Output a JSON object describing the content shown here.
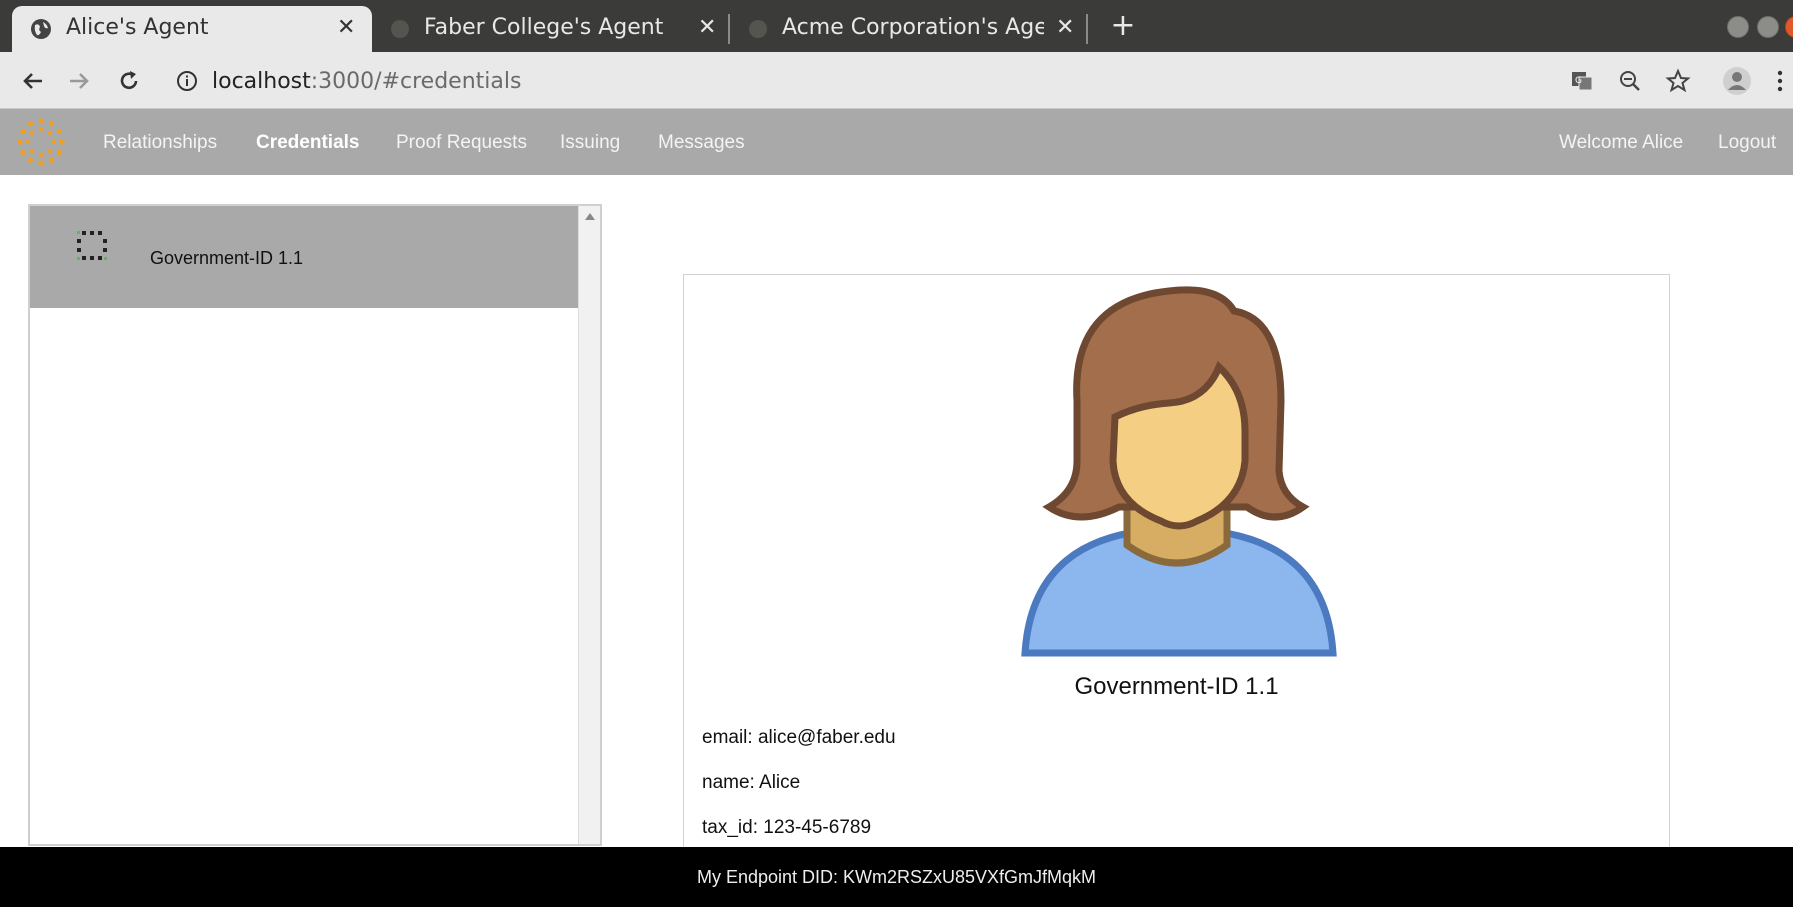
{
  "browser": {
    "tabs": [
      {
        "title": "Alice's Agent",
        "active": true
      },
      {
        "title": "Faber College's Agent",
        "active": false
      },
      {
        "title": "Acme Corporation's Agent",
        "active": false
      }
    ],
    "new_tab_label": "+",
    "close_glyph": "✕",
    "url_host": "localhost",
    "url_path": ":3000/#credentials",
    "icons": [
      "globe-icon",
      "back-arrow-icon",
      "forward-arrow-icon",
      "reload-icon",
      "info-icon",
      "translate-icon",
      "zoom-out-icon",
      "star-icon",
      "profile-icon",
      "menu-dots-icon"
    ]
  },
  "app": {
    "nav": {
      "items": [
        "Relationships",
        "Credentials",
        "Proof Requests",
        "Issuing",
        "Messages"
      ],
      "active": "Credentials",
      "welcome": "Welcome Alice",
      "logout": "Logout"
    },
    "credentials": [
      {
        "label": "Government-ID 1.1"
      }
    ],
    "detail": {
      "title": "Government-ID 1.1",
      "attributes": [
        {
          "key": "email",
          "value": "alice@faber.edu",
          "text": "email: alice@faber.edu"
        },
        {
          "key": "name",
          "value": "Alice",
          "text": "name: Alice"
        },
        {
          "key": "tax_id",
          "value": "123-45-6789",
          "text": "tax_id: 123-45-6789"
        }
      ]
    },
    "footer": "My Endpoint DID: KWm2RSZxU85VXfGmJfMqkM",
    "colors": {
      "nav_bg": "#a9a9a9",
      "logo": "#f0a020",
      "footer_bg": "#000000"
    }
  }
}
